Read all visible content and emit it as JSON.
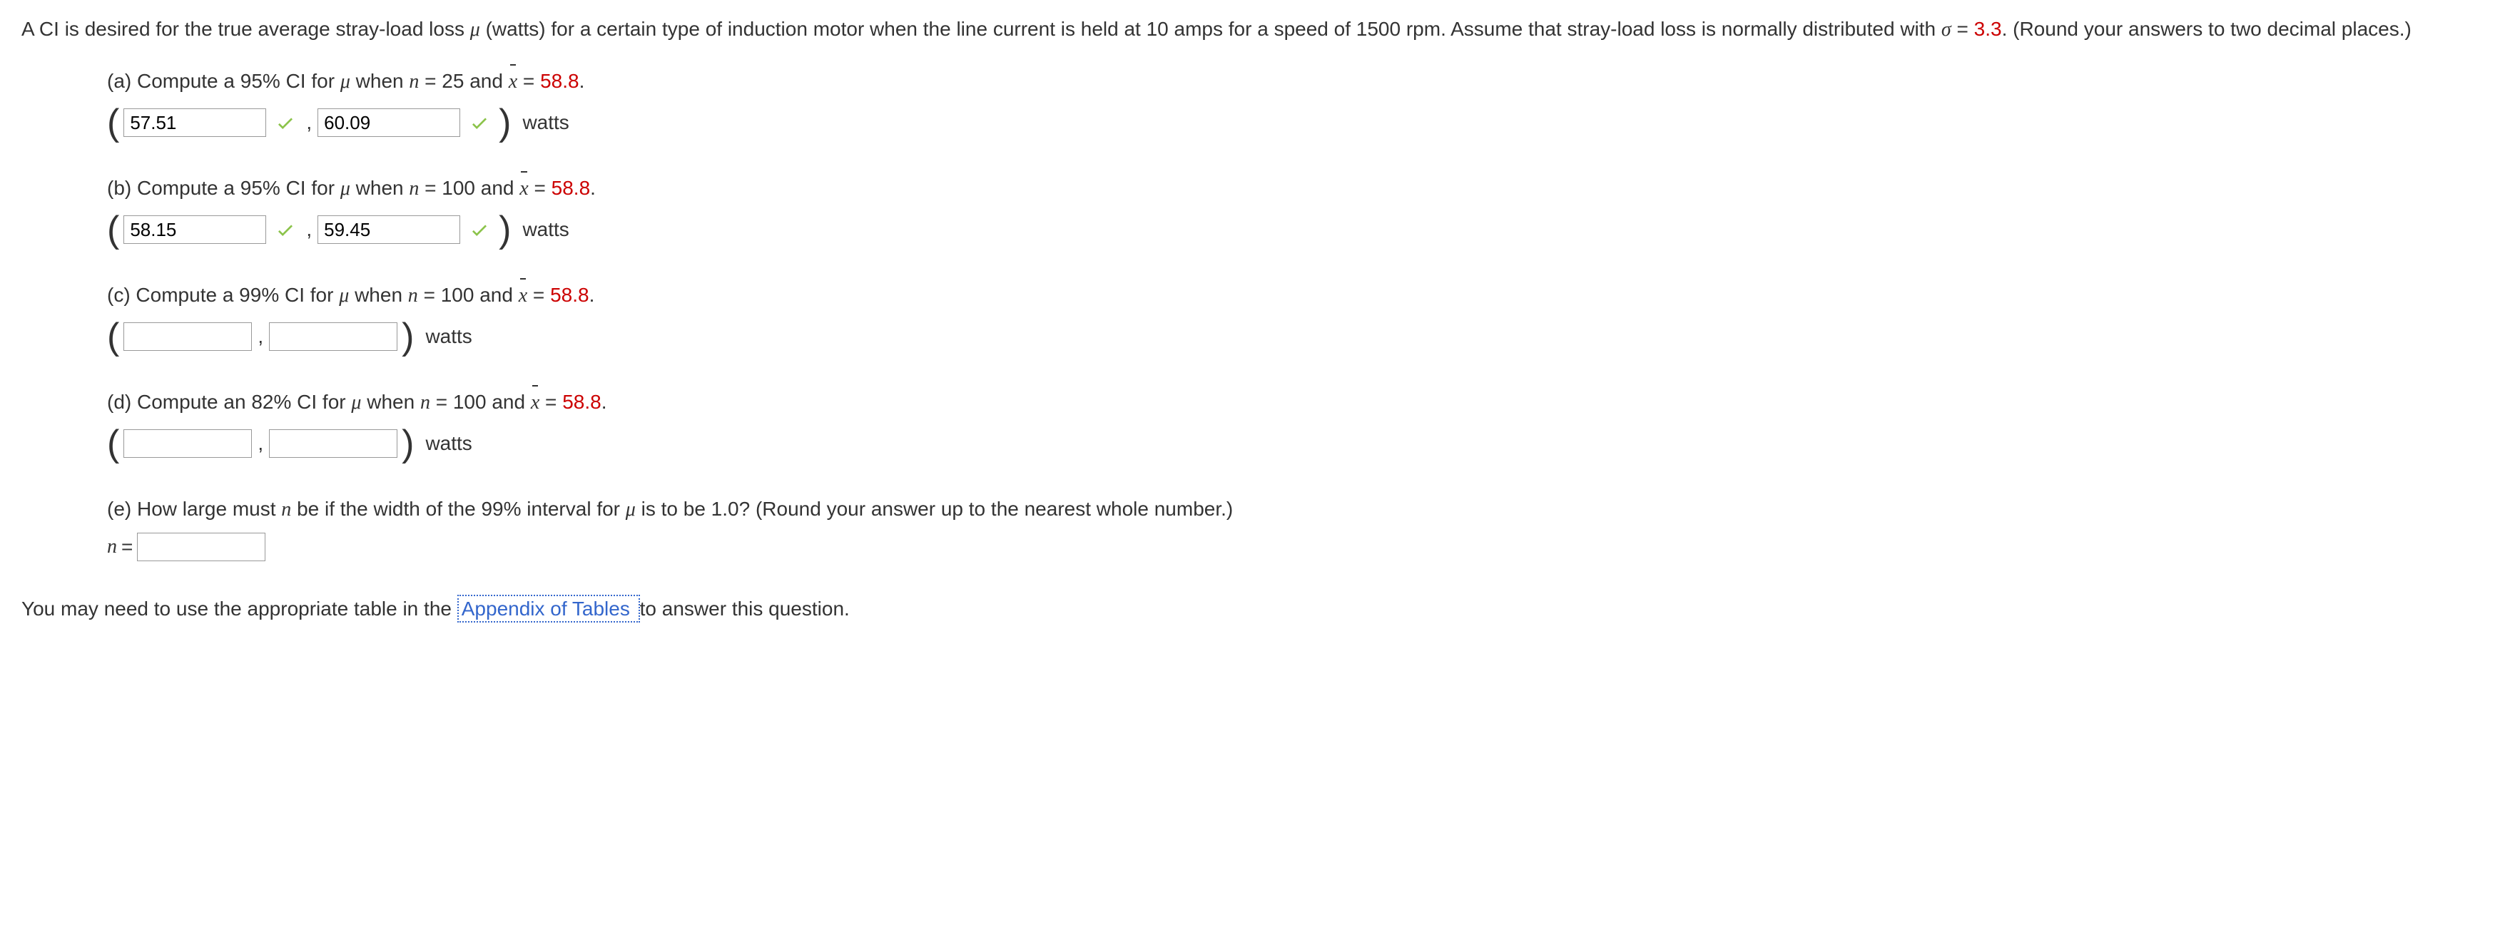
{
  "intro": {
    "text1": "A CI is desired for the true average stray-load loss ",
    "mu": "μ",
    "text2": " (watts) for a certain type of induction motor when the line current is held at 10 amps for a speed of 1500 rpm. Assume that stray-load loss is normally distributed with ",
    "sigma": "σ",
    "eq": " = ",
    "sigma_val": "3.3",
    "text3": ". (Round your answers to two decimal places.)"
  },
  "parts": {
    "a": {
      "label": "(a) Compute a 95% CI for ",
      "when": " when ",
      "n_text": "n",
      "n_eq": " = 25 and ",
      "xbar": "x",
      "x_eq": " = ",
      "x_val": "58.8",
      "period": ".",
      "lower": "57.51",
      "upper": "60.09",
      "unit": "watts"
    },
    "b": {
      "label": "(b) Compute a 95% CI for ",
      "when": " when ",
      "n_text": "n",
      "n_eq": " = 100 and ",
      "xbar": "x",
      "x_eq": " = ",
      "x_val": "58.8",
      "period": ".",
      "lower": "58.15",
      "upper": "59.45",
      "unit": "watts"
    },
    "c": {
      "label": "(c) Compute a 99% CI for ",
      "when": " when ",
      "n_text": "n",
      "n_eq": " = 100 and ",
      "xbar": "x",
      "x_eq": " = ",
      "x_val": "58.8",
      "period": ".",
      "lower": "",
      "upper": "",
      "unit": "watts"
    },
    "d": {
      "label": "(d) Compute an 82% CI for ",
      "when": " when ",
      "n_text": "n",
      "n_eq": " = 100 and ",
      "xbar": "x",
      "x_eq": " = ",
      "x_val": "58.8",
      "period": ".",
      "lower": "",
      "upper": "",
      "unit": "watts"
    },
    "e": {
      "label": "(e) How large must ",
      "n_text": "n",
      "rest": " be if the width of the 99% interval for ",
      "mu": "μ",
      "rest2": " is to be 1.0? (Round your answer up to the nearest whole number.)",
      "n_eq": "n",
      "eq_sign": " = ",
      "value": ""
    }
  },
  "footer": {
    "text1": "You may need to use the appropriate table in the ",
    "link": "Appendix of Tables ",
    "text2": "to answer this question."
  },
  "symbols": {
    "comma": ","
  }
}
